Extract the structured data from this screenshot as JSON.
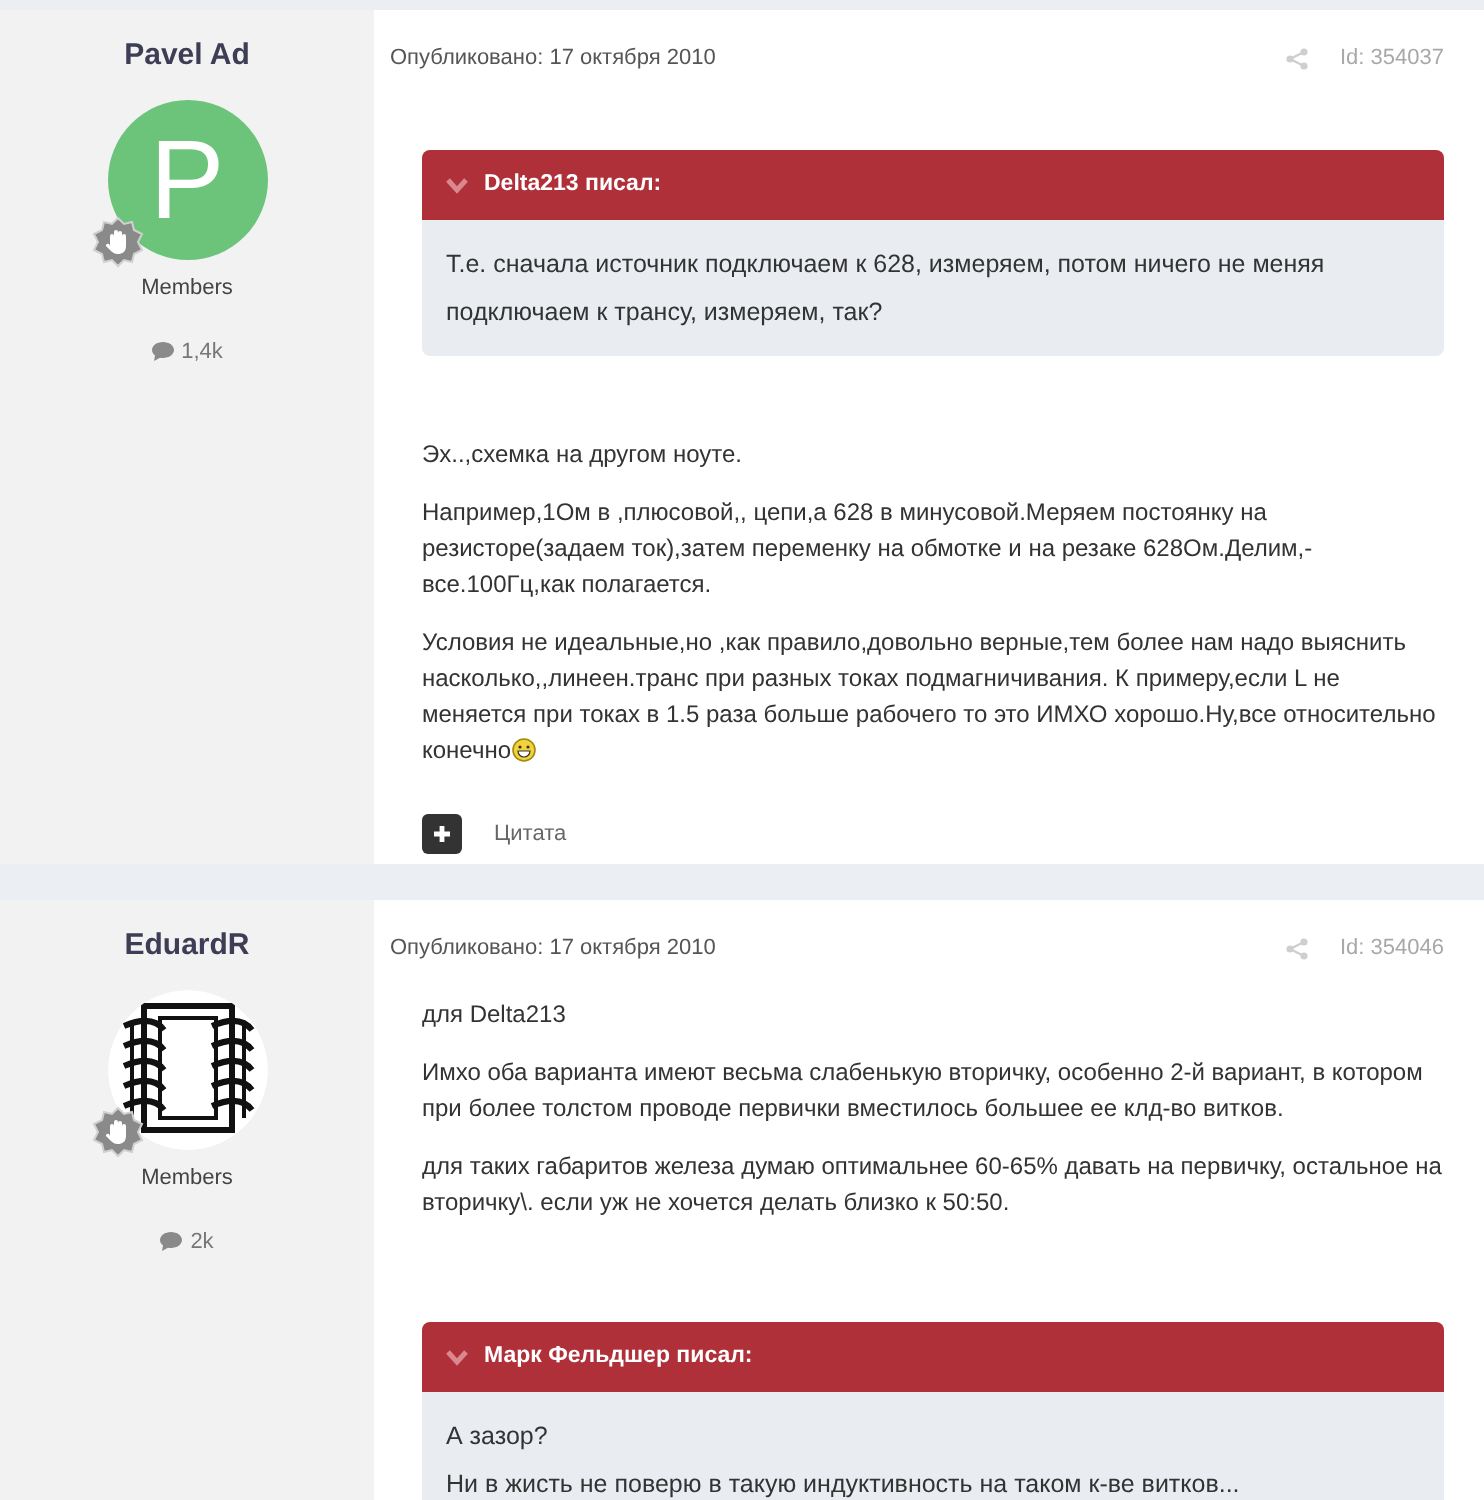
{
  "posts": [
    {
      "author": {
        "name": "Pavel Ad",
        "avatar": {
          "kind": "letter",
          "letter": "P",
          "color": "#6cc47a"
        },
        "group": "Members",
        "post_count": "1,4k"
      },
      "published": "Опубликовано: 17 октября 2010",
      "post_id": "Id: 354037",
      "blocks": [
        {
          "kind": "quote",
          "author": "Delta213 писал:",
          "lines": [
            "Т.е. сначала источник подключаем к 628, измеряем, потом ничего не меняя подключаем к трансу, измеряем, так?"
          ]
        },
        {
          "kind": "paragraph",
          "text": "Эх..,схемка на другом ноуте."
        },
        {
          "kind": "paragraph",
          "text": "Например,1Ом в ,плюсовой,, цепи,а 628 в минусовой.Меряем постоянку на резисторе(задаем ток),затем переменку на обмотке и на резаке 628Ом.Делим,-все.100Гц,как полагается."
        },
        {
          "kind": "paragraph",
          "text": "Условия не идеальные,но ,как правило,довольно верные,тем более нам надо выяснить насколько,,линеен.транс при разных токах подмагничивания. К примеру,если L не меняется при токах в 1.5 раза больше рабочего то это ИМХО хорошо.Ну,все относительно конечно",
          "smiley": true
        }
      ],
      "footer": {
        "quote_label": "Цитата"
      }
    },
    {
      "author": {
        "name": "EduardR",
        "group": "Members",
        "post_count": "2k"
      },
      "published": "Опубликовано: 17 октября 2010",
      "post_id": "Id: 354046",
      "blocks": [
        {
          "kind": "paragraph",
          "text": "для Delta213"
        },
        {
          "kind": "paragraph",
          "text": "Имхо оба варианта имеют весьма слабенькую вторичку, особенно 2-й вариант, в котором при более толстом проводе первички вместилось большее ее клд-во витков."
        },
        {
          "kind": "paragraph",
          "text": "для таких габаритов железа думаю оптимальнее 60-65% давать на первичку, остальное на вторичку\\. если уж не хочется делать близко к 50:50."
        },
        {
          "kind": "quote",
          "author": "Марк Фельдшер писал:",
          "lines": [
            "А зазор?",
            "Ни в жисть не поверю в такую индуктивность на таком к-ве витков..."
          ]
        }
      ]
    }
  ]
}
